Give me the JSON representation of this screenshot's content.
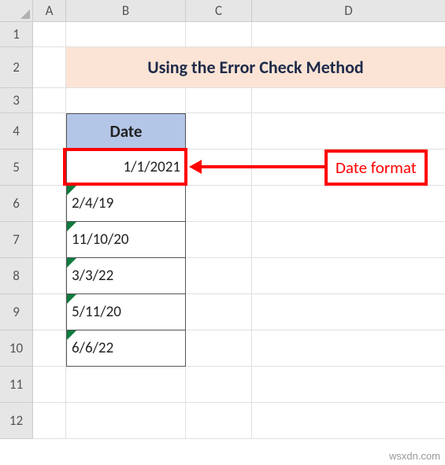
{
  "columns": {
    "A": "A",
    "B": "B",
    "C": "C",
    "D": "D"
  },
  "rows": [
    "1",
    "2",
    "3",
    "4",
    "5",
    "6",
    "7",
    "8",
    "9",
    "10",
    "11",
    "12"
  ],
  "title": "Using the Error Check Method",
  "table": {
    "header": "Date",
    "rows": [
      "1/1/2021",
      "2/4/19",
      "11/10/20",
      "3/3/22",
      "5/11/20",
      "6/6/22"
    ]
  },
  "callout": "Date format",
  "watermark": "wsxdn.com"
}
